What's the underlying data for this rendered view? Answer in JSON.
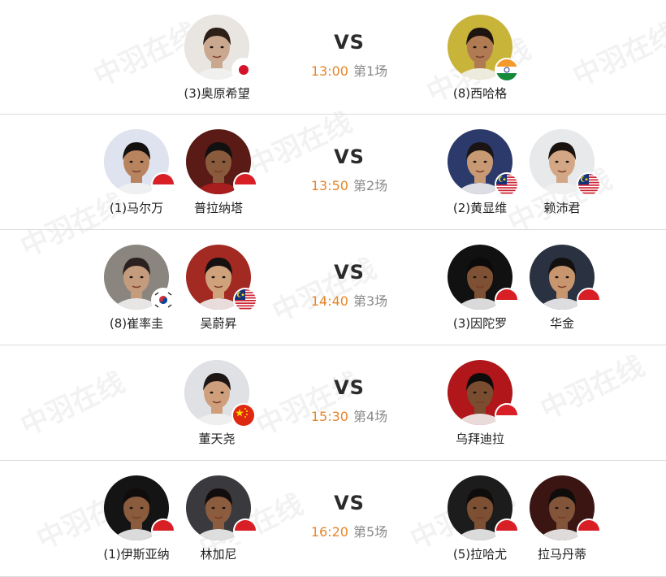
{
  "matches": [
    {
      "vs": "VS",
      "time": "13:00",
      "round": "第1场",
      "left": [
        {
          "name": "(3)奥原希望",
          "flag": "japan",
          "face": "#caa88f",
          "hair": "#2b1f17",
          "bg": "#e9e6e2"
        }
      ],
      "right": [
        {
          "name": "(8)西哈格",
          "flag": "india",
          "face": "#b07a52",
          "hair": "#1d140f",
          "bg": "#c9b43a"
        }
      ]
    },
    {
      "vs": "VS",
      "time": "13:50",
      "round": "第2场",
      "left": [
        {
          "name": "(1)马尔万",
          "flag": "indonesia",
          "face": "#b8845f",
          "hair": "#141010",
          "bg": "#dfe3ef"
        },
        {
          "name": "普拉纳塔",
          "flag": "indonesia",
          "face": "#8a5a3d",
          "hair": "#111",
          "bg": "#5a1a16"
        }
      ],
      "right": [
        {
          "name": "(2)黄显维",
          "flag": "malaysia",
          "face": "#c89a74",
          "hair": "#1a1414",
          "bg": "#2b3a6a"
        },
        {
          "name": "赖沛君",
          "flag": "malaysia",
          "face": "#d3a785",
          "hair": "#1a120e",
          "bg": "#e7e9ea"
        }
      ]
    },
    {
      "vs": "VS",
      "time": "14:40",
      "round": "第3场",
      "left": [
        {
          "name": "(8)崔率圭",
          "flag": "korea",
          "face": "#c49b7d",
          "hair": "#2a2020",
          "bg": "#8b857f"
        },
        {
          "name": "吴蔚昇",
          "flag": "malaysia",
          "face": "#d0a27c",
          "hair": "#161010",
          "bg": "#a22a22"
        }
      ],
      "right": [
        {
          "name": "(3)因陀罗",
          "flag": "indonesia",
          "face": "#7e5134",
          "hair": "#0c0a0a",
          "bg": "#111111"
        },
        {
          "name": "华金",
          "flag": "indonesia",
          "face": "#c8966e",
          "hair": "#131010",
          "bg": "#2a3140"
        }
      ]
    },
    {
      "vs": "VS",
      "time": "15:30",
      "round": "第4场",
      "left": [
        {
          "name": "董天尧",
          "flag": "china",
          "face": "#cf9f7c",
          "hair": "#1c1614",
          "bg": "#dfe1e5"
        }
      ],
      "right": [
        {
          "name": "乌拜迪拉",
          "flag": "indonesia",
          "face": "#7a4d31",
          "hair": "#0e0b0b",
          "bg": "#b0161a"
        }
      ]
    },
    {
      "vs": "VS",
      "time": "16:20",
      "round": "第5场",
      "left": [
        {
          "name": "(1)伊斯亚纳",
          "flag": "indonesia",
          "face": "#8a5b3c",
          "hair": "#100c0c",
          "bg": "#141414"
        },
        {
          "name": "林加尼",
          "flag": "indonesia",
          "face": "#8c5c3e",
          "hair": "#120d0d",
          "bg": "#3a3a3e"
        }
      ],
      "right": [
        {
          "name": "(5)拉哈尤",
          "flag": "indonesia",
          "face": "#7d5033",
          "hair": "#0f0c0c",
          "bg": "#1c1c1c"
        },
        {
          "name": "拉马丹蒂",
          "flag": "indonesia",
          "face": "#82553a",
          "hair": "#100c0c",
          "bg": "#3a1512"
        }
      ]
    }
  ],
  "watermark": {
    "text": "中羽在线",
    "sub": "BADMINTONCN.COM"
  }
}
